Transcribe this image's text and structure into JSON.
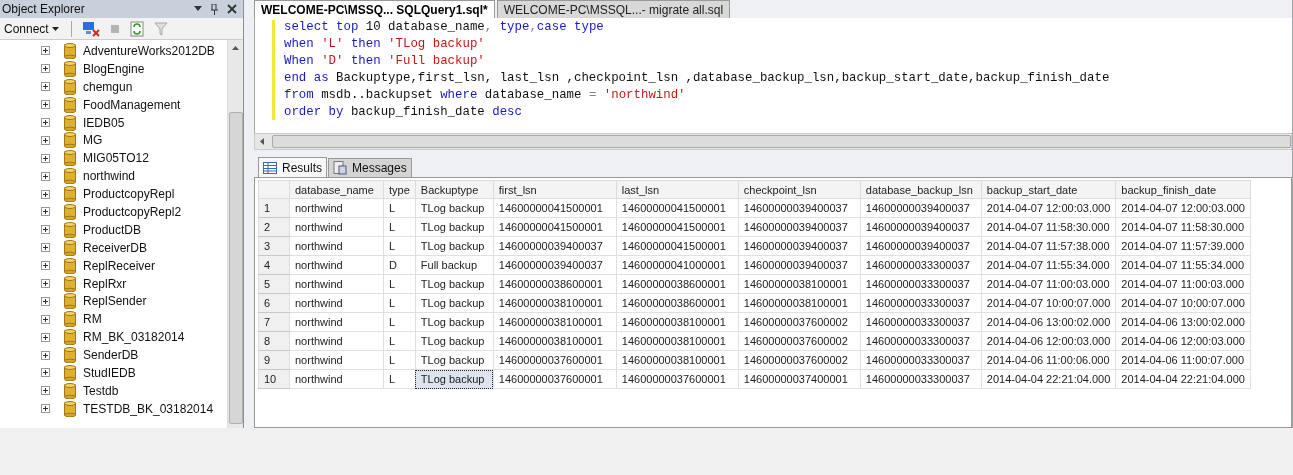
{
  "object_explorer": {
    "title": "Object Explorer",
    "connect": "Connect",
    "databases": [
      "AdventureWorks2012DB",
      "BlogEngine",
      "chemgun",
      "FoodManagement",
      "IEDB05",
      "MG",
      "MIG05TO12",
      "northwind",
      "ProductcopyRepl",
      "ProductcopyRepl2",
      "ProductDB",
      "ReceiverDB",
      "ReplReceiver",
      "ReplRxr",
      "ReplSender",
      "RM",
      "RM_BK_03182014",
      "SenderDB",
      "StudIEDB",
      "Testdb",
      "TESTDB_BK_03182014"
    ]
  },
  "document_tabs": [
    {
      "label": "WELCOME-PC\\MSSQ... SQLQuery1.sql*",
      "selected": true
    },
    {
      "label": "WELCOME-PC\\MSSQL...- migrate all.sql",
      "selected": false
    }
  ],
  "editor": {
    "lines": [
      [
        {
          "kind": "kw",
          "text": "select top"
        },
        {
          "kind": "plain",
          "text": " 10 database_name"
        },
        {
          "kind": "op",
          "text": ","
        },
        {
          "kind": "kw",
          "text": " type"
        },
        {
          "kind": "op",
          "text": ","
        },
        {
          "kind": "kw",
          "text": "case type"
        }
      ],
      [
        {
          "kind": "kw",
          "text": "when"
        },
        {
          "kind": "str",
          "text": " 'L'"
        },
        {
          "kind": "kw",
          "text": " then"
        },
        {
          "kind": "str",
          "text": " 'TLog backup'"
        }
      ],
      [
        {
          "kind": "kw",
          "text": "When"
        },
        {
          "kind": "str",
          "text": " 'D'"
        },
        {
          "kind": "kw",
          "text": " then"
        },
        {
          "kind": "str",
          "text": " 'Full backup'"
        }
      ],
      [
        {
          "kind": "kw",
          "text": "end as"
        },
        {
          "kind": "plain",
          "text": " Backuptype,first_lsn, last_lsn ,checkpoint_lsn ,database_backup_lsn,backup_start_date,backup_finish_date"
        }
      ],
      [
        {
          "kind": "kw",
          "text": "from"
        },
        {
          "kind": "plain",
          "text": " msdb..backupset "
        },
        {
          "kind": "kw",
          "text": "where"
        },
        {
          "kind": "plain",
          "text": " database_name "
        },
        {
          "kind": "op",
          "text": "="
        },
        {
          "kind": "str",
          "text": " 'northwind'"
        }
      ],
      [
        {
          "kind": "kw",
          "text": "order by"
        },
        {
          "kind": "plain",
          "text": " backup_finish_date "
        },
        {
          "kind": "kw",
          "text": "desc"
        }
      ]
    ]
  },
  "result_tabs": [
    {
      "label": "Results",
      "selected": true
    },
    {
      "label": "Messages",
      "selected": false
    }
  ],
  "table": {
    "columns": [
      "database_name",
      "type",
      "Backuptype",
      "first_lsn",
      "last_lsn",
      "checkpoint_lsn",
      "database_backup_lsn",
      "backup_start_date",
      "backup_finish_date"
    ],
    "rows": [
      {
        "number": "1",
        "cells": [
          {
            "text": "northwind",
            "selected": false
          },
          {
            "text": "L",
            "selected": false
          },
          {
            "text": "TLog backup",
            "selected": false
          },
          {
            "text": "14600000041500001",
            "selected": false
          },
          {
            "text": "14600000041500001",
            "selected": false
          },
          {
            "text": "14600000039400037",
            "selected": false
          },
          {
            "text": "14600000039400037",
            "selected": false
          },
          {
            "text": "2014-04-07 12:00:03.000",
            "selected": false
          },
          {
            "text": "2014-04-07 12:00:03.000",
            "selected": false
          }
        ]
      },
      {
        "number": "2",
        "cells": [
          {
            "text": "northwind",
            "selected": false
          },
          {
            "text": "L",
            "selected": false
          },
          {
            "text": "TLog backup",
            "selected": false
          },
          {
            "text": "14600000041500001",
            "selected": false
          },
          {
            "text": "14600000041500001",
            "selected": false
          },
          {
            "text": "14600000039400037",
            "selected": false
          },
          {
            "text": "14600000039400037",
            "selected": false
          },
          {
            "text": "2014-04-07 11:58:30.000",
            "selected": false
          },
          {
            "text": "2014-04-07 11:58:30.000",
            "selected": false
          }
        ]
      },
      {
        "number": "3",
        "cells": [
          {
            "text": "northwind",
            "selected": false
          },
          {
            "text": "L",
            "selected": false
          },
          {
            "text": "TLog backup",
            "selected": false
          },
          {
            "text": "14600000039400037",
            "selected": false
          },
          {
            "text": "14600000041500001",
            "selected": false
          },
          {
            "text": "14600000039400037",
            "selected": false
          },
          {
            "text": "14600000039400037",
            "selected": false
          },
          {
            "text": "2014-04-07 11:57:38.000",
            "selected": false
          },
          {
            "text": "2014-04-07 11:57:39.000",
            "selected": false
          }
        ]
      },
      {
        "number": "4",
        "cells": [
          {
            "text": "northwind",
            "selected": false
          },
          {
            "text": "D",
            "selected": false
          },
          {
            "text": "Full backup",
            "selected": false
          },
          {
            "text": "14600000039400037",
            "selected": false
          },
          {
            "text": "14600000041000001",
            "selected": false
          },
          {
            "text": "14600000039400037",
            "selected": false
          },
          {
            "text": "14600000033300037",
            "selected": false
          },
          {
            "text": "2014-04-07 11:55:34.000",
            "selected": false
          },
          {
            "text": "2014-04-07 11:55:34.000",
            "selected": false
          }
        ]
      },
      {
        "number": "5",
        "cells": [
          {
            "text": "northwind",
            "selected": false
          },
          {
            "text": "L",
            "selected": false
          },
          {
            "text": "TLog backup",
            "selected": false
          },
          {
            "text": "14600000038600001",
            "selected": false
          },
          {
            "text": "14600000038600001",
            "selected": false
          },
          {
            "text": "14600000038100001",
            "selected": false
          },
          {
            "text": "14600000033300037",
            "selected": false
          },
          {
            "text": "2014-04-07 11:00:03.000",
            "selected": false
          },
          {
            "text": "2014-04-07 11:00:03.000",
            "selected": false
          }
        ]
      },
      {
        "number": "6",
        "cells": [
          {
            "text": "northwind",
            "selected": false
          },
          {
            "text": "L",
            "selected": false
          },
          {
            "text": "TLog backup",
            "selected": false
          },
          {
            "text": "14600000038100001",
            "selected": false
          },
          {
            "text": "14600000038600001",
            "selected": false
          },
          {
            "text": "14600000038100001",
            "selected": false
          },
          {
            "text": "14600000033300037",
            "selected": false
          },
          {
            "text": "2014-04-07 10:00:07.000",
            "selected": false
          },
          {
            "text": "2014-04-07 10:00:07.000",
            "selected": false
          }
        ]
      },
      {
        "number": "7",
        "cells": [
          {
            "text": "northwind",
            "selected": false
          },
          {
            "text": "L",
            "selected": false
          },
          {
            "text": "TLog backup",
            "selected": false
          },
          {
            "text": "14600000038100001",
            "selected": false
          },
          {
            "text": "14600000038100001",
            "selected": false
          },
          {
            "text": "14600000037600002",
            "selected": false
          },
          {
            "text": "14600000033300037",
            "selected": false
          },
          {
            "text": "2014-04-06 13:00:02.000",
            "selected": false
          },
          {
            "text": "2014-04-06 13:00:02.000",
            "selected": false
          }
        ]
      },
      {
        "number": "8",
        "cells": [
          {
            "text": "northwind",
            "selected": false
          },
          {
            "text": "L",
            "selected": false
          },
          {
            "text": "TLog backup",
            "selected": false
          },
          {
            "text": "14600000038100001",
            "selected": false
          },
          {
            "text": "14600000038100001",
            "selected": false
          },
          {
            "text": "14600000037600002",
            "selected": false
          },
          {
            "text": "14600000033300037",
            "selected": false
          },
          {
            "text": "2014-04-06 12:00:03.000",
            "selected": false
          },
          {
            "text": "2014-04-06 12:00:03.000",
            "selected": false
          }
        ]
      },
      {
        "number": "9",
        "cells": [
          {
            "text": "northwind",
            "selected": false
          },
          {
            "text": "L",
            "selected": false
          },
          {
            "text": "TLog backup",
            "selected": false
          },
          {
            "text": "14600000037600001",
            "selected": false
          },
          {
            "text": "14600000038100001",
            "selected": false
          },
          {
            "text": "14600000037600002",
            "selected": false
          },
          {
            "text": "14600000033300037",
            "selected": false
          },
          {
            "text": "2014-04-06 11:00:06.000",
            "selected": false
          },
          {
            "text": "2014-04-06 11:00:07.000",
            "selected": false
          }
        ]
      },
      {
        "number": "10",
        "cells": [
          {
            "text": "northwind",
            "selected": false
          },
          {
            "text": "L",
            "selected": false
          },
          {
            "text": "TLog backup",
            "selected": true
          },
          {
            "text": "14600000037600001",
            "selected": false
          },
          {
            "text": "14600000037600001",
            "selected": false
          },
          {
            "text": "14600000037400001",
            "selected": false
          },
          {
            "text": "14600000033300037",
            "selected": false
          },
          {
            "text": "2014-04-04 22:21:04.000",
            "selected": false
          },
          {
            "text": "2014-04-04 22:21:04.000",
            "selected": false
          }
        ]
      }
    ]
  }
}
